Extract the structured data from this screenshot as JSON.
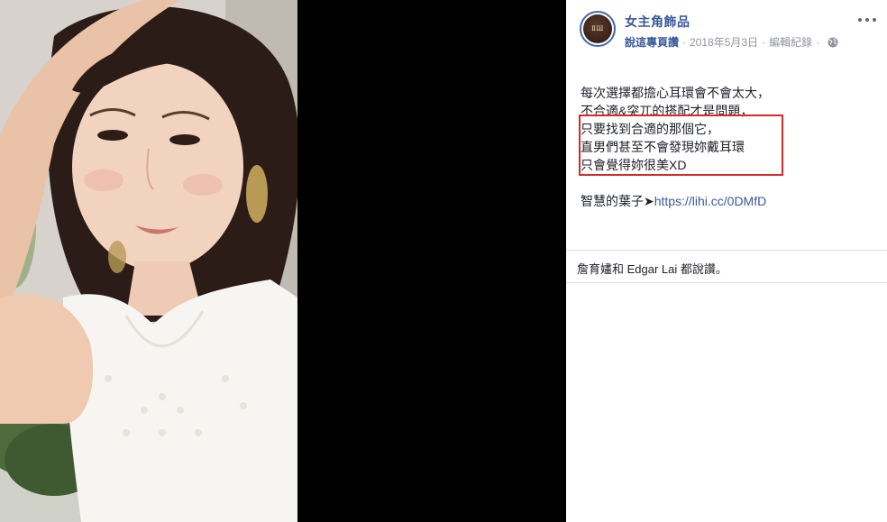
{
  "photo": {
    "description_icon": "portrait-photo"
  },
  "post": {
    "page_name": "女主角飾品",
    "avatar_text": "ⅡШ",
    "like_page": "說這專頁讚",
    "date": "2018年5月3日",
    "edit_history": "編輯紀錄",
    "separator": "·",
    "privacy_icon": "globe-icon",
    "more_icon": "more-options-icon",
    "text_lines": [
      "每次選擇都擔心耳環會不會太大，",
      "不合適&突兀的搭配才是問題，",
      "只要找到合適的那個它，",
      "直男們甚至不會發現妳戴耳環",
      "只會覺得妳很美XD"
    ],
    "link_prefix": "智慧的葉子➤",
    "link_text": "https://lihi.cc/0DMfD"
  },
  "reactions": {
    "text": "詹育嫿和 Edgar Lai 都說讚。"
  },
  "colors": {
    "brand_link": "#385898",
    "highlight": "#d42a2a",
    "meta_text": "#90949c",
    "stage_bg": "#000000"
  }
}
